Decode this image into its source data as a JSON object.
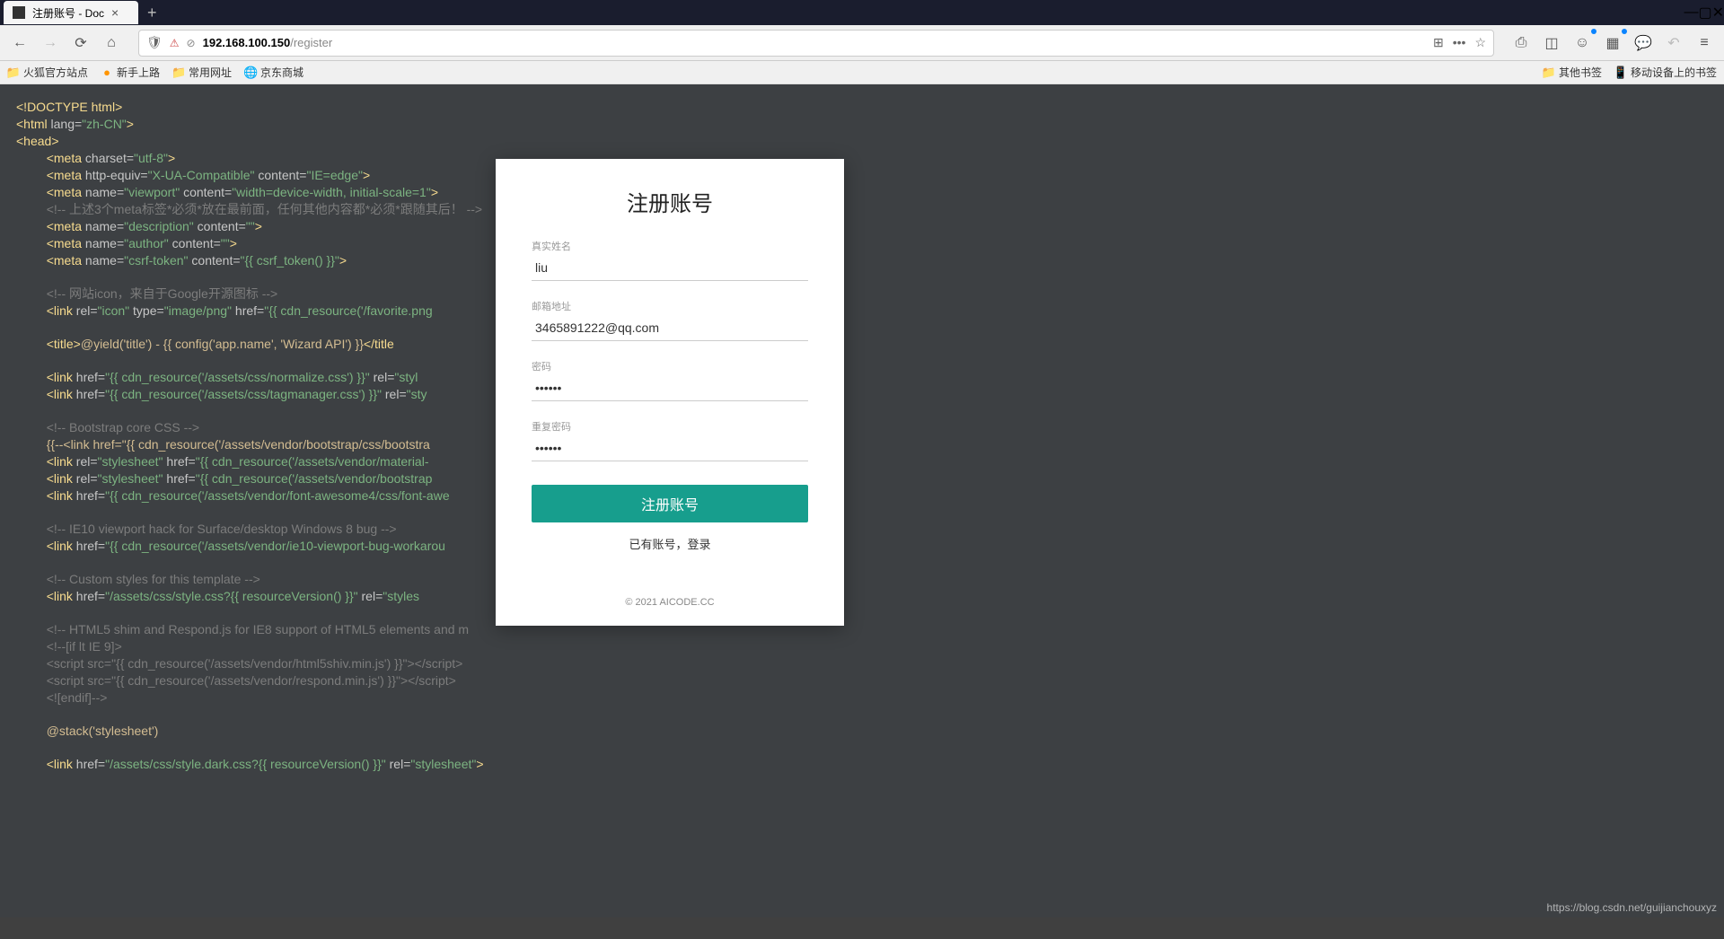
{
  "window": {
    "tab_title": "注册账号 - Doc"
  },
  "url": {
    "host": "192.168.100.150",
    "path": "/register"
  },
  "bookmarks": {
    "left": [
      "火狐官方站点",
      "新手上路",
      "常用网址",
      "京东商城"
    ],
    "right": [
      "其他书签",
      "移动设备上的书签"
    ]
  },
  "form": {
    "title": "注册账号",
    "labels": {
      "name": "真实姓名",
      "email": "邮箱地址",
      "password": "密码",
      "confirm": "重复密码"
    },
    "values": {
      "name": "liu",
      "email": "3465891222@qq.com",
      "password": "••••••",
      "confirm": "••••••"
    },
    "submit": "注册账号",
    "login_link": "已有账号，登录",
    "copyright": "© 2021 AICODE.CC"
  },
  "watermark": "https://blog.csdn.net/guijianchouxyz",
  "code_lines": [
    {
      "segments": [
        {
          "t": "<!DOCTYPE html>",
          "c": "tag"
        }
      ]
    },
    {
      "segments": [
        {
          "t": "<html ",
          "c": "tag"
        },
        {
          "t": "lang=",
          "c": "attr"
        },
        {
          "t": "\"zh-CN\"",
          "c": "str"
        },
        {
          "t": ">",
          "c": "tag"
        }
      ]
    },
    {
      "segments": [
        {
          "t": "<head>",
          "c": "tag"
        }
      ]
    },
    {
      "indent": 1,
      "segments": [
        {
          "t": "<meta ",
          "c": "tag"
        },
        {
          "t": "charset=",
          "c": "attr"
        },
        {
          "t": "\"utf-8\"",
          "c": "str"
        },
        {
          "t": ">",
          "c": "tag"
        }
      ]
    },
    {
      "indent": 1,
      "segments": [
        {
          "t": "<meta ",
          "c": "tag"
        },
        {
          "t": "http-equiv=",
          "c": "attr"
        },
        {
          "t": "\"X-UA-Compatible\"",
          "c": "str"
        },
        {
          "t": " content=",
          "c": "attr"
        },
        {
          "t": "\"IE=edge\"",
          "c": "str"
        },
        {
          "t": ">",
          "c": "tag"
        }
      ]
    },
    {
      "indent": 1,
      "segments": [
        {
          "t": "<meta ",
          "c": "tag"
        },
        {
          "t": "name=",
          "c": "attr"
        },
        {
          "t": "\"viewport\"",
          "c": "str"
        },
        {
          "t": " content=",
          "c": "attr"
        },
        {
          "t": "\"width=device-width, initial-scale=1\"",
          "c": "str"
        },
        {
          "t": ">",
          "c": "tag"
        }
      ]
    },
    {
      "indent": 1,
      "segments": [
        {
          "t": "<!-- 上述3个meta标签*必须*放在最前面，任何其他内容都*必须*跟随其后！ -->",
          "c": "cmt"
        }
      ]
    },
    {
      "indent": 1,
      "segments": [
        {
          "t": "<meta ",
          "c": "tag"
        },
        {
          "t": "name=",
          "c": "attr"
        },
        {
          "t": "\"description\"",
          "c": "str"
        },
        {
          "t": " content=",
          "c": "attr"
        },
        {
          "t": "\"\"",
          "c": "str"
        },
        {
          "t": ">",
          "c": "tag"
        }
      ]
    },
    {
      "indent": 1,
      "segments": [
        {
          "t": "<meta ",
          "c": "tag"
        },
        {
          "t": "name=",
          "c": "attr"
        },
        {
          "t": "\"author\"",
          "c": "str"
        },
        {
          "t": " content=",
          "c": "attr"
        },
        {
          "t": "\"\"",
          "c": "str"
        },
        {
          "t": ">",
          "c": "tag"
        }
      ]
    },
    {
      "indent": 1,
      "segments": [
        {
          "t": "<meta ",
          "c": "tag"
        },
        {
          "t": "name=",
          "c": "attr"
        },
        {
          "t": "\"csrf-token\"",
          "c": "str"
        },
        {
          "t": " content=",
          "c": "attr"
        },
        {
          "t": "\"{{ csrf_token() }}\"",
          "c": "str"
        },
        {
          "t": ">",
          "c": "tag"
        }
      ]
    },
    {
      "segments": []
    },
    {
      "indent": 1,
      "segments": [
        {
          "t": "<!-- 网站icon，来自于Google开源图标 -->",
          "c": "cmt"
        }
      ]
    },
    {
      "indent": 1,
      "segments": [
        {
          "t": "<link ",
          "c": "tag"
        },
        {
          "t": "rel=",
          "c": "attr"
        },
        {
          "t": "\"icon\"",
          "c": "str"
        },
        {
          "t": " type=",
          "c": "attr"
        },
        {
          "t": "\"image/png\"",
          "c": "str"
        },
        {
          "t": " href=",
          "c": "attr"
        },
        {
          "t": "\"{{ cdn_resource('/favorite.png",
          "c": "str"
        }
      ]
    },
    {
      "segments": []
    },
    {
      "indent": 1,
      "segments": [
        {
          "t": "<title>",
          "c": "tag"
        },
        {
          "t": "@yield('title') - {{ config('app.name', 'Wizard API') }}",
          "c": "blade"
        },
        {
          "t": "</title",
          "c": "tag"
        }
      ]
    },
    {
      "segments": []
    },
    {
      "indent": 1,
      "segments": [
        {
          "t": "<link ",
          "c": "tag"
        },
        {
          "t": "href=",
          "c": "attr"
        },
        {
          "t": "\"{{ cdn_resource('/assets/css/normalize.css') }}\"",
          "c": "str"
        },
        {
          "t": " rel=",
          "c": "attr"
        },
        {
          "t": "\"styl",
          "c": "str"
        }
      ]
    },
    {
      "indent": 1,
      "segments": [
        {
          "t": "<link ",
          "c": "tag"
        },
        {
          "t": "href=",
          "c": "attr"
        },
        {
          "t": "\"{{ cdn_resource('/assets/css/tagmanager.css') }}\"",
          "c": "str"
        },
        {
          "t": " rel=",
          "c": "attr"
        },
        {
          "t": "\"sty",
          "c": "str"
        }
      ]
    },
    {
      "segments": []
    },
    {
      "indent": 1,
      "segments": [
        {
          "t": "<!-- Bootstrap core CSS -->",
          "c": "cmt"
        }
      ]
    },
    {
      "indent": 1,
      "segments": [
        {
          "t": "{{--<link href=\"{{ cdn_resource('/assets/vendor/bootstrap/css/bootstra",
          "c": "blade"
        }
      ]
    },
    {
      "indent": 1,
      "segments": [
        {
          "t": "<link ",
          "c": "tag"
        },
        {
          "t": "rel=",
          "c": "attr"
        },
        {
          "t": "\"stylesheet\"",
          "c": "str"
        },
        {
          "t": " href=",
          "c": "attr"
        },
        {
          "t": "\"{{ cdn_resource('/assets/vendor/material-",
          "c": "str"
        }
      ]
    },
    {
      "indent": 1,
      "segments": [
        {
          "t": "<link ",
          "c": "tag"
        },
        {
          "t": "rel=",
          "c": "attr"
        },
        {
          "t": "\"stylesheet\"",
          "c": "str"
        },
        {
          "t": " href=",
          "c": "attr"
        },
        {
          "t": "\"{{ cdn_resource('/assets/vendor/bootstrap                                                        s') }}\"",
          "c": "str"
        },
        {
          "t": ">",
          "c": "tag"
        }
      ]
    },
    {
      "indent": 1,
      "segments": [
        {
          "t": "<link ",
          "c": "tag"
        },
        {
          "t": "href=",
          "c": "attr"
        },
        {
          "t": "\"{{ cdn_resource('/assets/vendor/font-awesome4/css/font-awe",
          "c": "str"
        }
      ]
    },
    {
      "segments": []
    },
    {
      "indent": 1,
      "segments": [
        {
          "t": "<!-- IE10 viewport hack for Surface/desktop Windows 8 bug -->",
          "c": "cmt"
        }
      ]
    },
    {
      "indent": 1,
      "segments": [
        {
          "t": "<link ",
          "c": "tag"
        },
        {
          "t": "href=",
          "c": "attr"
        },
        {
          "t": "\"{{ cdn_resource('/assets/vendor/ie10-viewport-bug-workarou",
          "c": "str"
        }
      ]
    },
    {
      "segments": []
    },
    {
      "indent": 1,
      "segments": [
        {
          "t": "<!-- Custom styles for this template -->",
          "c": "cmt"
        }
      ]
    },
    {
      "indent": 1,
      "segments": [
        {
          "t": "<link ",
          "c": "tag"
        },
        {
          "t": "href=",
          "c": "attr"
        },
        {
          "t": "\"/assets/css/style.css?{{ resourceVersion() }}\"",
          "c": "str"
        },
        {
          "t": " rel=",
          "c": "attr"
        },
        {
          "t": "\"styles",
          "c": "str"
        }
      ]
    },
    {
      "segments": []
    },
    {
      "indent": 1,
      "segments": [
        {
          "t": "<!-- HTML5 shim and Respond.js for IE8 support of HTML5 elements and m",
          "c": "cmt"
        }
      ]
    },
    {
      "indent": 1,
      "segments": [
        {
          "t": "<!--[if lt IE 9]>",
          "c": "cmt"
        }
      ]
    },
    {
      "indent": 1,
      "segments": [
        {
          "t": "<script src=\"{{ cdn_resource('/assets/vendor/html5shiv.min.js') }}\"></script>",
          "c": "cmt"
        }
      ]
    },
    {
      "indent": 1,
      "segments": [
        {
          "t": "<script src=\"{{ cdn_resource('/assets/vendor/respond.min.js') }}\"></script>",
          "c": "cmt"
        }
      ]
    },
    {
      "indent": 1,
      "segments": [
        {
          "t": "<![endif]-->",
          "c": "cmt"
        }
      ]
    },
    {
      "segments": []
    },
    {
      "indent": 1,
      "segments": [
        {
          "t": "@stack('stylesheet')",
          "c": "blade"
        }
      ]
    },
    {
      "segments": []
    },
    {
      "indent": 1,
      "segments": [
        {
          "t": "<link ",
          "c": "tag"
        },
        {
          "t": "href=",
          "c": "attr"
        },
        {
          "t": "\"/assets/css/style.dark.css?{{ resourceVersion() }}\"",
          "c": "str"
        },
        {
          "t": " rel=",
          "c": "attr"
        },
        {
          "t": "\"stylesheet\"",
          "c": "str"
        },
        {
          "t": ">",
          "c": "tag"
        }
      ]
    }
  ]
}
